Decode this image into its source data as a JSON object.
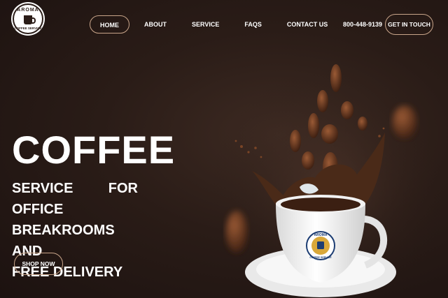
{
  "brand": {
    "logo_top": "AROMA",
    "logo_bottom": "COFFEE SERVICE"
  },
  "nav": {
    "items": [
      {
        "label": "HOME",
        "active": true
      },
      {
        "label": "ABOUT"
      },
      {
        "label": "SERVICE"
      },
      {
        "label": "FAQS"
      },
      {
        "label": "CONTACT US"
      }
    ],
    "phone": "800-448-9139",
    "cta": "GET IN TOUCH"
  },
  "hero": {
    "title": "COFFEE",
    "lines": [
      "SERVICE FOR OFFICE",
      "BREAKROOMS AND",
      "FREE DELIVERY"
    ],
    "button": "SHOP NOW",
    "cup_logo_top": "AROMA",
    "cup_logo_bottom": "COFFEE SERVICE"
  },
  "colors": {
    "background": "#2a1c17",
    "accent_border": "#c9a58a",
    "coffee": "#4a2a18"
  },
  "icons": [
    "coffee-cup-logo",
    "coffee-beans",
    "coffee-cup"
  ]
}
